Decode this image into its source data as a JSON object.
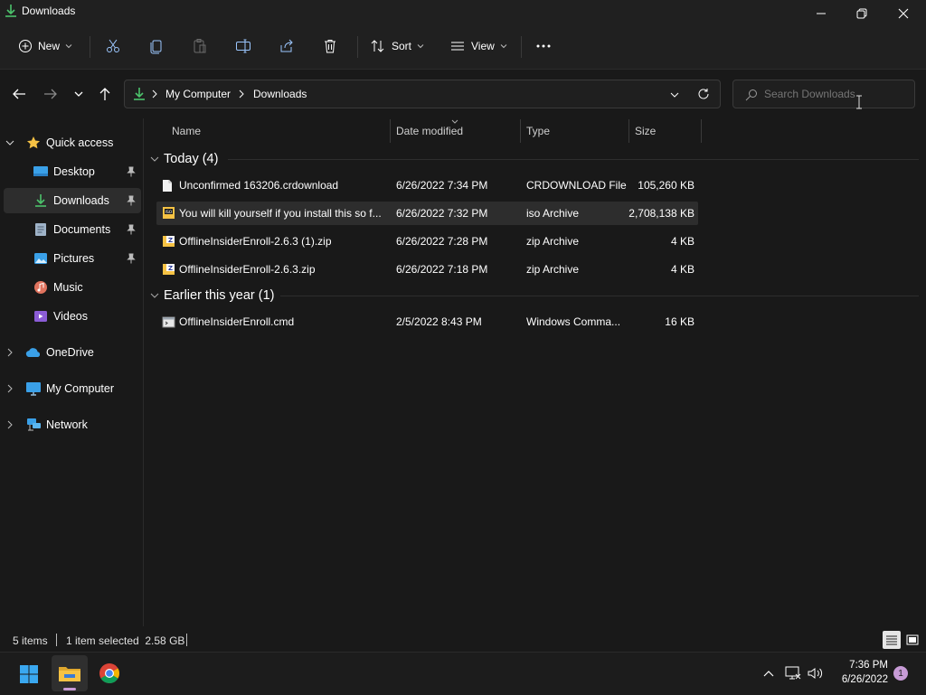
{
  "window": {
    "title": "Downloads"
  },
  "toolbar": {
    "new_label": "New",
    "sort_label": "Sort",
    "view_label": "View"
  },
  "address": {
    "crumbs": [
      "My Computer",
      "Downloads"
    ]
  },
  "search": {
    "placeholder": "Search Downloads"
  },
  "sidebar": {
    "quick_access": "Quick access",
    "items": [
      {
        "label": "Desktop",
        "icon": "desktop-icon",
        "pinned": true
      },
      {
        "label": "Downloads",
        "icon": "downloads-icon",
        "pinned": true,
        "selected": true
      },
      {
        "label": "Documents",
        "icon": "documents-icon",
        "pinned": true
      },
      {
        "label": "Pictures",
        "icon": "pictures-icon",
        "pinned": true
      },
      {
        "label": "Music",
        "icon": "music-icon",
        "pinned": false
      },
      {
        "label": "Videos",
        "icon": "videos-icon",
        "pinned": false
      }
    ],
    "onedrive": "OneDrive",
    "mycomputer": "My Computer",
    "network": "Network"
  },
  "list": {
    "columns": [
      "Name",
      "Date modified",
      "Type",
      "Size"
    ],
    "groups": [
      {
        "title": "Today (4)",
        "files": [
          {
            "name": "Unconfirmed 163206.crdownload",
            "date": "6/26/2022 7:34 PM",
            "type": "CRDOWNLOAD File",
            "size": "105,260 KB",
            "icon": "file-icon"
          },
          {
            "name": "You will kill yourself if you install this so f...",
            "date": "6/26/2022 7:32 PM",
            "type": "iso Archive",
            "size": "2,708,138 KB",
            "icon": "iso-archive-icon",
            "selected": true
          },
          {
            "name": "OfflineInsiderEnroll-2.6.3 (1).zip",
            "date": "6/26/2022 7:28 PM",
            "type": "zip Archive",
            "size": "4 KB",
            "icon": "zip-archive-icon"
          },
          {
            "name": "OfflineInsiderEnroll-2.6.3.zip",
            "date": "6/26/2022 7:18 PM",
            "type": "zip Archive",
            "size": "4 KB",
            "icon": "zip-archive-icon"
          }
        ]
      },
      {
        "title": "Earlier this year (1)",
        "files": [
          {
            "name": "OfflineInsiderEnroll.cmd",
            "date": "2/5/2022 8:43 PM",
            "type": "Windows Comma...",
            "size": "16 KB",
            "icon": "cmd-file-icon"
          }
        ]
      }
    ]
  },
  "status": {
    "count": "5 items",
    "selected": "1 item selected  2.58 GB"
  },
  "taskbar": {
    "time": "7:36 PM",
    "date": "6/26/2022",
    "notifications": "1"
  },
  "colors": {
    "accent": "#0078d4",
    "folder": "#f6c244",
    "download_green": "#4cc26b",
    "notif_badge": "#c79bd6"
  }
}
